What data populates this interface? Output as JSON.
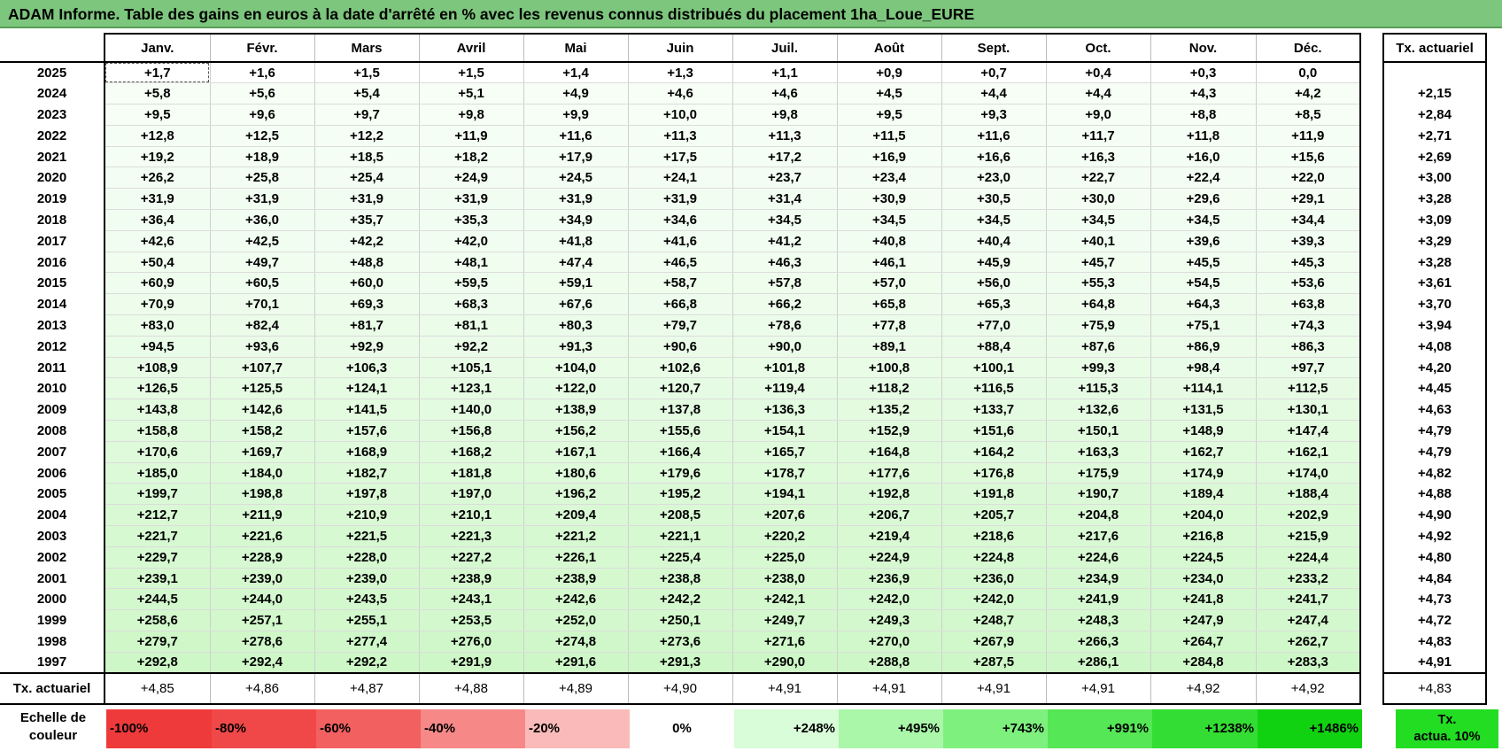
{
  "title": "ADAM Informe. Table des gains en euros à la date d'arrêté en % avec les revenus connus distribués du placement 1ha_Loue_EURE",
  "months": [
    "Janv.",
    "Févr.",
    "Mars",
    "Avril",
    "Mai",
    "Juin",
    "Juil.",
    "Août",
    "Sept.",
    "Oct.",
    "Nov.",
    "Déc."
  ],
  "tx_header": "Tx. actuariel",
  "rows": [
    {
      "year": "2025",
      "vals": [
        "+1,7",
        "+1,6",
        "+1,5",
        "+1,5",
        "+1,4",
        "+1,3",
        "+1,1",
        "+0,9",
        "+0,7",
        "+0,4",
        "+0,3",
        "0,0"
      ],
      "tx": ""
    },
    {
      "year": "2024",
      "vals": [
        "+5,8",
        "+5,6",
        "+5,4",
        "+5,1",
        "+4,9",
        "+4,6",
        "+4,6",
        "+4,5",
        "+4,4",
        "+4,4",
        "+4,3",
        "+4,2"
      ],
      "tx": "+2,15"
    },
    {
      "year": "2023",
      "vals": [
        "+9,5",
        "+9,6",
        "+9,7",
        "+9,8",
        "+9,9",
        "+10,0",
        "+9,8",
        "+9,5",
        "+9,3",
        "+9,0",
        "+8,8",
        "+8,5"
      ],
      "tx": "+2,84"
    },
    {
      "year": "2022",
      "vals": [
        "+12,8",
        "+12,5",
        "+12,2",
        "+11,9",
        "+11,6",
        "+11,3",
        "+11,3",
        "+11,5",
        "+11,6",
        "+11,7",
        "+11,8",
        "+11,9"
      ],
      "tx": "+2,71"
    },
    {
      "year": "2021",
      "vals": [
        "+19,2",
        "+18,9",
        "+18,5",
        "+18,2",
        "+17,9",
        "+17,5",
        "+17,2",
        "+16,9",
        "+16,6",
        "+16,3",
        "+16,0",
        "+15,6"
      ],
      "tx": "+2,69"
    },
    {
      "year": "2020",
      "vals": [
        "+26,2",
        "+25,8",
        "+25,4",
        "+24,9",
        "+24,5",
        "+24,1",
        "+23,7",
        "+23,4",
        "+23,0",
        "+22,7",
        "+22,4",
        "+22,0"
      ],
      "tx": "+3,00"
    },
    {
      "year": "2019",
      "vals": [
        "+31,9",
        "+31,9",
        "+31,9",
        "+31,9",
        "+31,9",
        "+31,9",
        "+31,4",
        "+30,9",
        "+30,5",
        "+30,0",
        "+29,6",
        "+29,1"
      ],
      "tx": "+3,28"
    },
    {
      "year": "2018",
      "vals": [
        "+36,4",
        "+36,0",
        "+35,7",
        "+35,3",
        "+34,9",
        "+34,6",
        "+34,5",
        "+34,5",
        "+34,5",
        "+34,5",
        "+34,5",
        "+34,4"
      ],
      "tx": "+3,09"
    },
    {
      "year": "2017",
      "vals": [
        "+42,6",
        "+42,5",
        "+42,2",
        "+42,0",
        "+41,8",
        "+41,6",
        "+41,2",
        "+40,8",
        "+40,4",
        "+40,1",
        "+39,6",
        "+39,3"
      ],
      "tx": "+3,29"
    },
    {
      "year": "2016",
      "vals": [
        "+50,4",
        "+49,7",
        "+48,8",
        "+48,1",
        "+47,4",
        "+46,5",
        "+46,3",
        "+46,1",
        "+45,9",
        "+45,7",
        "+45,5",
        "+45,3"
      ],
      "tx": "+3,28"
    },
    {
      "year": "2015",
      "vals": [
        "+60,9",
        "+60,5",
        "+60,0",
        "+59,5",
        "+59,1",
        "+58,7",
        "+57,8",
        "+57,0",
        "+56,0",
        "+55,3",
        "+54,5",
        "+53,6"
      ],
      "tx": "+3,61"
    },
    {
      "year": "2014",
      "vals": [
        "+70,9",
        "+70,1",
        "+69,3",
        "+68,3",
        "+67,6",
        "+66,8",
        "+66,2",
        "+65,8",
        "+65,3",
        "+64,8",
        "+64,3",
        "+63,8"
      ],
      "tx": "+3,70"
    },
    {
      "year": "2013",
      "vals": [
        "+83,0",
        "+82,4",
        "+81,7",
        "+81,1",
        "+80,3",
        "+79,7",
        "+78,6",
        "+77,8",
        "+77,0",
        "+75,9",
        "+75,1",
        "+74,3"
      ],
      "tx": "+3,94"
    },
    {
      "year": "2012",
      "vals": [
        "+94,5",
        "+93,6",
        "+92,9",
        "+92,2",
        "+91,3",
        "+90,6",
        "+90,0",
        "+89,1",
        "+88,4",
        "+87,6",
        "+86,9",
        "+86,3"
      ],
      "tx": "+4,08"
    },
    {
      "year": "2011",
      "vals": [
        "+108,9",
        "+107,7",
        "+106,3",
        "+105,1",
        "+104,0",
        "+102,6",
        "+101,8",
        "+100,8",
        "+100,1",
        "+99,3",
        "+98,4",
        "+97,7"
      ],
      "tx": "+4,20"
    },
    {
      "year": "2010",
      "vals": [
        "+126,5",
        "+125,5",
        "+124,1",
        "+123,1",
        "+122,0",
        "+120,7",
        "+119,4",
        "+118,2",
        "+116,5",
        "+115,3",
        "+114,1",
        "+112,5"
      ],
      "tx": "+4,45"
    },
    {
      "year": "2009",
      "vals": [
        "+143,8",
        "+142,6",
        "+141,5",
        "+140,0",
        "+138,9",
        "+137,8",
        "+136,3",
        "+135,2",
        "+133,7",
        "+132,6",
        "+131,5",
        "+130,1"
      ],
      "tx": "+4,63"
    },
    {
      "year": "2008",
      "vals": [
        "+158,8",
        "+158,2",
        "+157,6",
        "+156,8",
        "+156,2",
        "+155,6",
        "+154,1",
        "+152,9",
        "+151,6",
        "+150,1",
        "+148,9",
        "+147,4"
      ],
      "tx": "+4,79"
    },
    {
      "year": "2007",
      "vals": [
        "+170,6",
        "+169,7",
        "+168,9",
        "+168,2",
        "+167,1",
        "+166,4",
        "+165,7",
        "+164,8",
        "+164,2",
        "+163,3",
        "+162,7",
        "+162,1"
      ],
      "tx": "+4,79"
    },
    {
      "year": "2006",
      "vals": [
        "+185,0",
        "+184,0",
        "+182,7",
        "+181,8",
        "+180,6",
        "+179,6",
        "+178,7",
        "+177,6",
        "+176,8",
        "+175,9",
        "+174,9",
        "+174,0"
      ],
      "tx": "+4,82"
    },
    {
      "year": "2005",
      "vals": [
        "+199,7",
        "+198,8",
        "+197,8",
        "+197,0",
        "+196,2",
        "+195,2",
        "+194,1",
        "+192,8",
        "+191,8",
        "+190,7",
        "+189,4",
        "+188,4"
      ],
      "tx": "+4,88"
    },
    {
      "year": "2004",
      "vals": [
        "+212,7",
        "+211,9",
        "+210,9",
        "+210,1",
        "+209,4",
        "+208,5",
        "+207,6",
        "+206,7",
        "+205,7",
        "+204,8",
        "+204,0",
        "+202,9"
      ],
      "tx": "+4,90"
    },
    {
      "year": "2003",
      "vals": [
        "+221,7",
        "+221,6",
        "+221,5",
        "+221,3",
        "+221,2",
        "+221,1",
        "+220,2",
        "+219,4",
        "+218,6",
        "+217,6",
        "+216,8",
        "+215,9"
      ],
      "tx": "+4,92"
    },
    {
      "year": "2002",
      "vals": [
        "+229,7",
        "+228,9",
        "+228,0",
        "+227,2",
        "+226,1",
        "+225,4",
        "+225,0",
        "+224,9",
        "+224,8",
        "+224,6",
        "+224,5",
        "+224,4"
      ],
      "tx": "+4,80"
    },
    {
      "year": "2001",
      "vals": [
        "+239,1",
        "+239,0",
        "+239,0",
        "+238,9",
        "+238,9",
        "+238,8",
        "+238,0",
        "+236,9",
        "+236,0",
        "+234,9",
        "+234,0",
        "+233,2"
      ],
      "tx": "+4,84"
    },
    {
      "year": "2000",
      "vals": [
        "+244,5",
        "+244,0",
        "+243,5",
        "+243,1",
        "+242,6",
        "+242,2",
        "+242,1",
        "+242,0",
        "+242,0",
        "+241,9",
        "+241,8",
        "+241,7"
      ],
      "tx": "+4,73"
    },
    {
      "year": "1999",
      "vals": [
        "+258,6",
        "+257,1",
        "+255,1",
        "+253,5",
        "+252,0",
        "+250,1",
        "+249,7",
        "+249,3",
        "+248,7",
        "+248,3",
        "+247,9",
        "+247,4"
      ],
      "tx": "+4,72"
    },
    {
      "year": "1998",
      "vals": [
        "+279,7",
        "+278,6",
        "+277,4",
        "+276,0",
        "+274,8",
        "+273,6",
        "+271,6",
        "+270,0",
        "+267,9",
        "+266,3",
        "+264,7",
        "+262,7"
      ],
      "tx": "+4,83"
    },
    {
      "year": "1997",
      "vals": [
        "+292,8",
        "+292,4",
        "+292,2",
        "+291,9",
        "+291,6",
        "+291,3",
        "+290,0",
        "+288,8",
        "+287,5",
        "+286,1",
        "+284,8",
        "+283,3"
      ],
      "tx": "+4,91"
    }
  ],
  "footer": {
    "label": "Tx. actuariel",
    "vals": [
      "+4,85",
      "+4,86",
      "+4,87",
      "+4,88",
      "+4,89",
      "+4,90",
      "+4,91",
      "+4,91",
      "+4,91",
      "+4,91",
      "+4,92",
      "+4,92"
    ],
    "tx": "+4,83"
  },
  "scale": {
    "label_line1": "Echelle de",
    "label_line2": "couleur",
    "items": [
      {
        "label": "-100%",
        "color": "#ee3a3a"
      },
      {
        "label": "-80%",
        "color": "#f04848"
      },
      {
        "label": "-60%",
        "color": "#f26060"
      },
      {
        "label": "-40%",
        "color": "#f68888"
      },
      {
        "label": "-20%",
        "color": "#fbbaba"
      },
      {
        "label": "0%",
        "color": "#ffffff"
      },
      {
        "label": "+248%",
        "color": "#d9fcd9"
      },
      {
        "label": "+495%",
        "color": "#aaf7aa"
      },
      {
        "label": "+743%",
        "color": "#7ef07e"
      },
      {
        "label": "+991%",
        "color": "#55e755"
      },
      {
        "label": "+1238%",
        "color": "#33dd33"
      },
      {
        "label": "+1486%",
        "color": "#11d211"
      }
    ],
    "tx_line1": "Tx.",
    "tx_line2": "actua. 10%",
    "tx_color": "#22dd22"
  },
  "max_value": 292.8
}
